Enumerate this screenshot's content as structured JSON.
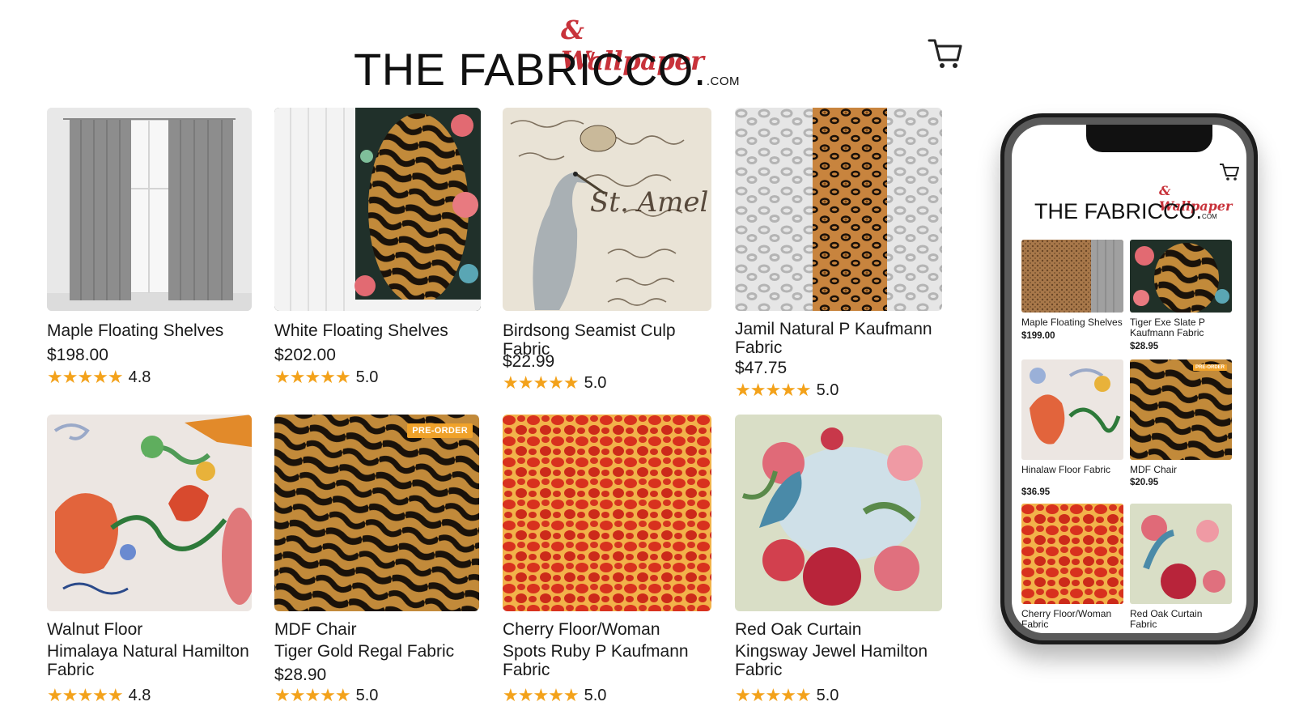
{
  "brand": {
    "script": "& Wallpaper",
    "name_left": "THE FABRIC",
    "name_right": "CO.",
    "suffix": ".COM",
    "accent_color": "#c8323a"
  },
  "header": {
    "cart_icon": "shopping-cart-icon"
  },
  "products": [
    {
      "title": "Maple Floating Shelves",
      "price": "$198.00",
      "stars": "★★★★★",
      "rating": "4.8",
      "image": "gray-curtains-window"
    },
    {
      "title": "White Floating Shelves",
      "price": "$202.00",
      "stars": "★★★★★",
      "rating": "5.0",
      "image": "white-curtain-tiger-rug"
    },
    {
      "title": "Birdsong Seamist Culp Fabric",
      "price": "$22.99",
      "stars": "★★★★★",
      "rating": "5.0",
      "image": "heron-script-fabric"
    },
    {
      "title": "Jamil Natural P Kaufmann Fabric",
      "price": "$47.75",
      "stars": "★★★★★",
      "rating": "5.0",
      "image": "leopard-print-panels"
    },
    {
      "title": "Walnut Floor",
      "subtitle": "Himalaya Natural Hamilton Fabric",
      "stars": "★★★★★",
      "rating": "4.8",
      "image": "chinoiserie-dragons"
    },
    {
      "title": "MDF Chair",
      "subtitle": "Tiger Gold Regal Fabric",
      "price": "$28.90",
      "stars": "★★★★★",
      "rating": "5.0",
      "badge": "PRE-ORDER",
      "image": "tiger-stripe-fabric"
    },
    {
      "title": "Cherry Floor/Woman",
      "subtitle": "Spots Ruby P Kaufmann Fabric",
      "stars": "★★★★★",
      "rating": "5.0",
      "image": "red-spots-fabric"
    },
    {
      "title": "Red Oak Curtain",
      "subtitle": "Kingsway Jewel Hamilton Fabric",
      "stars": "★★★★★",
      "rating": "5.0",
      "image": "floral-peacock-fabric"
    }
  ],
  "phone": {
    "brand_script": "& Wallpaper",
    "brand_left": "THE FABRIC",
    "brand_right": "CO.",
    "brand_suffix": "COM",
    "products": [
      {
        "title": "Maple Floating Shelves",
        "price": "$199.00"
      },
      {
        "title": "Tiger Exe Slate P Kaufmann Fabric",
        "price": "$28.95"
      },
      {
        "title": "Hinalaw Floor Fabric",
        "price": "$36.95"
      },
      {
        "title": "MDF Chair",
        "price": "$20.95",
        "badge": "PRE-ORDER"
      },
      {
        "title": "Cherry Floor/Woman Fabric",
        "price": ""
      },
      {
        "title": "Red Oak Curtain Fabric",
        "price": ""
      }
    ]
  }
}
